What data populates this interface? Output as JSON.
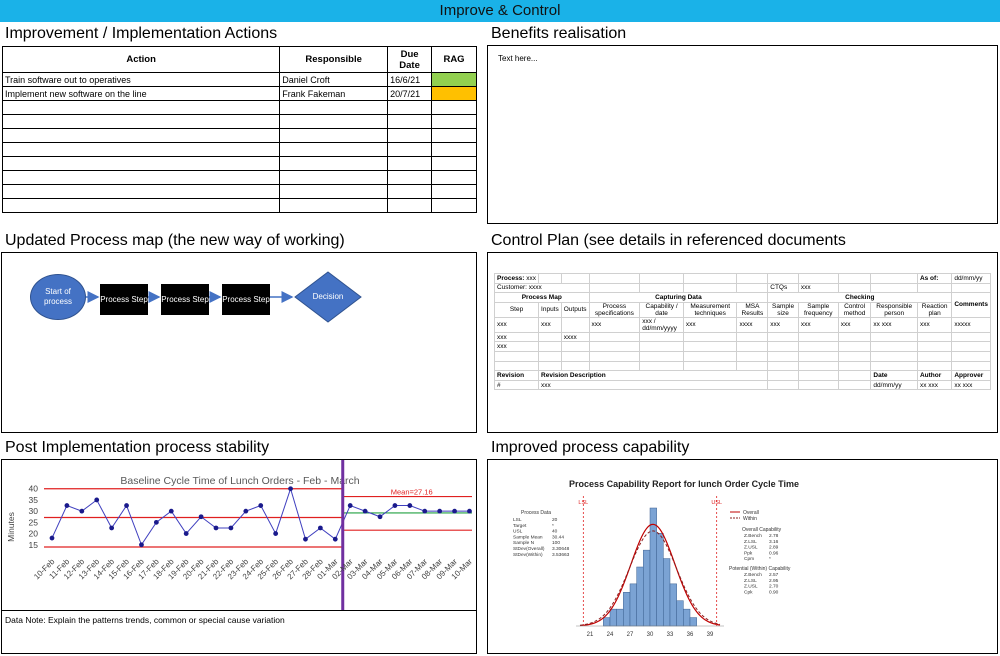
{
  "banner": {
    "title": "Improve & Control"
  },
  "sections": {
    "actions_title": "Improvement / Implementation Actions",
    "benefits_title": "Benefits realisation",
    "process_map_title": "Updated Process map (the new way of working)",
    "control_plan_title": "Control Plan (see details in referenced documents",
    "stability_title": "Post Implementation process stability",
    "capability_title": "Improved process capability"
  },
  "actions": {
    "headers": {
      "action": "Action",
      "responsible": "Responsible",
      "due_date": "Due Date",
      "rag": "RAG"
    },
    "rows": [
      {
        "action": "Train software out to operatives",
        "responsible": "Daniel Croft",
        "due": "16/6/21",
        "rag_color": "#92d050"
      },
      {
        "action": "Implement new software on the line",
        "responsible": "Frank Fakeman",
        "due": "20/7/21",
        "rag_color": "#ffc000"
      }
    ],
    "empty_rows": 8
  },
  "benefits": {
    "text": "Text here..."
  },
  "process_map": {
    "start_label": "Start of process",
    "steps": [
      "Process Step",
      "Process Step",
      "Process Step"
    ],
    "decision_label": "Decision",
    "colors": {
      "start": "#4472c4",
      "step": "#000000",
      "arrow": "#4472c4"
    }
  },
  "control_plan": {
    "process_label": "Process:",
    "process_value": "xxx",
    "as_of_label": "As of:",
    "as_of_value": "dd/mm/yy",
    "customer_label": "Customer:",
    "customer_value": "xxxx",
    "ctqs_label": "CTQs",
    "ctqs_value": "xxx",
    "groups": {
      "process_map": "Process Map",
      "capturing_data": "Capturing Data",
      "checking": "Checking",
      "comments": "Comments"
    },
    "columns": [
      "Step",
      "Inputs",
      "Outputs",
      "Process specifications",
      "Capability / date",
      "Measurement techniques",
      "MSA Results",
      "Sample size",
      "Sample frequency",
      "Control method",
      "Responsible person",
      "Reaction plan"
    ],
    "row1": [
      "xxx",
      "xxx",
      "",
      "xxx",
      "xxx / dd/mm/yyyy",
      "xxx",
      "xxxx",
      "xxx",
      "xxx",
      "xxx",
      "xx xxx",
      "xxx",
      "xxxxx"
    ],
    "row2_step": "xxx",
    "row2_outputs": "xxxx",
    "row3_step": "xxx",
    "revision_label": "Revision",
    "revision_desc_label": "Revision Description",
    "date_label": "Date",
    "author_label": "Author",
    "approver_label": "Approver",
    "revision_value": "#",
    "revision_desc_value": "xxx",
    "date_value": "dd/mm/yy",
    "author_value": "xx xxx",
    "approver_value": "xx xxx"
  },
  "stability": {
    "note": "Data Note: Explain the patterns trends, common or special cause variation",
    "overlay_text": "Mean=27.16"
  },
  "chart_data": [
    {
      "type": "line",
      "title": "Baseline Cycle Time of Lunch Orders - Feb - March",
      "ylabel": "Minutes",
      "ylim": [
        10,
        43
      ],
      "yticks": [
        15,
        20,
        25,
        30,
        35,
        40
      ],
      "x": [
        "10-Feb",
        "11-Feb",
        "12-Feb",
        "13-Feb",
        "14-Feb",
        "15-Feb",
        "16-Feb",
        "17-Feb",
        "18-Feb",
        "19-Feb",
        "20-Feb",
        "21-Feb",
        "22-Feb",
        "23-Feb",
        "24-Feb",
        "25-Feb",
        "26-Feb",
        "27-Feb",
        "28-Feb",
        "01-Mar",
        "02-Mar",
        "03-Mar",
        "04-Mar",
        "05-Mar",
        "06-Mar",
        "07-Mar",
        "08-Mar",
        "09-Mar",
        "10-Mar"
      ],
      "values": [
        18,
        32.5,
        30,
        35,
        22.5,
        32.5,
        15,
        25,
        30,
        20,
        27.5,
        22.5,
        22.5,
        30,
        32.5,
        20,
        40,
        17.5,
        22.5,
        17.5,
        32.5,
        30,
        27.5,
        32.5,
        32.5,
        30,
        30,
        30,
        30
      ],
      "phase_split_index": 20,
      "phase1_limits": {
        "ucl": 40,
        "mean": 27.16,
        "lcl": 14
      },
      "phase2_limits": {
        "ucl": 36.5,
        "mean": 29.2,
        "lcl": 21.5
      },
      "colors": {
        "series": "#3f3fbf",
        "points": "#1a1a8c",
        "limits": "#e02020",
        "mean2": "#20a040",
        "divider": "#7030a0"
      }
    },
    {
      "type": "histogram",
      "title": "Process Capability Report for lunch Order Cycle Time",
      "xticks": [
        21,
        24,
        27,
        30,
        33,
        36,
        39
      ],
      "bins": [
        {
          "x": 23.5,
          "count": 1
        },
        {
          "x": 24.5,
          "count": 2
        },
        {
          "x": 25.5,
          "count": 2
        },
        {
          "x": 26.5,
          "count": 4
        },
        {
          "x": 27.5,
          "count": 5
        },
        {
          "x": 28.5,
          "count": 7
        },
        {
          "x": 29.5,
          "count": 9
        },
        {
          "x": 30.5,
          "count": 14
        },
        {
          "x": 31.5,
          "count": 11
        },
        {
          "x": 32.5,
          "count": 8
        },
        {
          "x": 33.5,
          "count": 5
        },
        {
          "x": 34.5,
          "count": 3
        },
        {
          "x": 35.5,
          "count": 2
        },
        {
          "x": 36.5,
          "count": 1
        }
      ],
      "lsl": 20,
      "usl": 40,
      "mean": 30.44,
      "sd_overall": 3.30648,
      "sd_within": 3.53663,
      "lsl_label": "LSL",
      "usl_label": "USL",
      "legend": {
        "overall": "Overall",
        "within": "Within"
      },
      "process_data": {
        "title": "Process Data",
        "rows": [
          [
            "LSL",
            "20"
          ],
          [
            "Target",
            "*"
          ],
          [
            "USL",
            "40"
          ],
          [
            "Sample Mean",
            "30.44"
          ],
          [
            "Sample N",
            "100"
          ],
          [
            "StDev(Overall)",
            "3.30648"
          ],
          [
            "StDev(Within)",
            "3.53663"
          ]
        ]
      },
      "overall_capability": {
        "title": "Overall Capability",
        "rows": [
          [
            "Z.Bench",
            "2.78"
          ],
          [
            "Z.LSL",
            "3.16"
          ],
          [
            "Z.USL",
            "2.89"
          ],
          [
            "Ppk",
            "0.96"
          ],
          [
            "Cpm",
            "*"
          ]
        ]
      },
      "within_capability": {
        "title": "Potential (Within) Capability",
        "rows": [
          [
            "Z.Bench",
            "2.57"
          ],
          [
            "Z.LSL",
            "2.95"
          ],
          [
            "Z.USL",
            "2.70"
          ],
          [
            "Cpk",
            "0.90"
          ]
        ]
      },
      "colors": {
        "bars": "#7ba3d4",
        "bar_border": "#3b5f8f",
        "overall": "#c00000",
        "within": "#8b2020",
        "spec": "#e02020"
      }
    }
  ]
}
